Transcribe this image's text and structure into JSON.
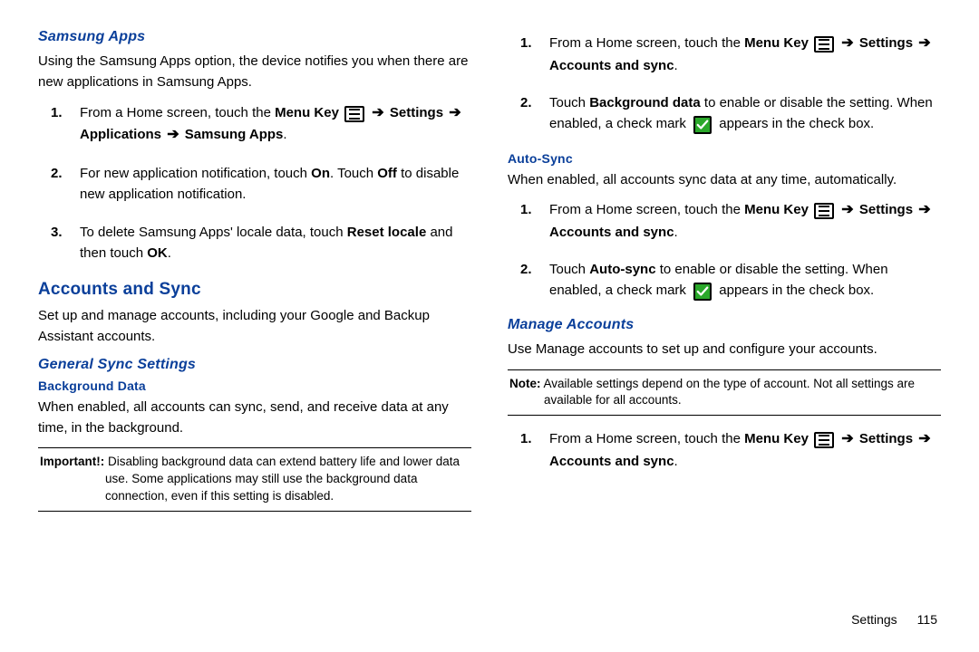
{
  "left": {
    "samsung_apps": {
      "title": "Samsung Apps",
      "intro": "Using the Samsung Apps option, the device notifies you when there are new applications in Samsung Apps.",
      "step1_pre": "From a Home screen, touch the ",
      "menu_key": "Menu Key",
      "settings": "Settings",
      "step1_path2": "Applications",
      "step1_path3": "Samsung Apps",
      "period": ".",
      "step2_a": "For new application notification, touch ",
      "on": "On",
      "step2_b": ". Touch ",
      "off": "Off",
      "step2_c": " to disable new application notification.",
      "step3_a": "To delete Samsung Apps' locale data, touch ",
      "reset_locale": "Reset locale",
      "step3_b": " and then touch ",
      "ok": "OK"
    },
    "accounts": {
      "title": "Accounts and Sync",
      "intro": "Set up and manage accounts, including your Google and Backup Assistant accounts.",
      "general_title": "General Sync Settings",
      "bg_title": "Background Data",
      "bg_intro": "When enabled, all accounts can sync, send, and receive data at any time, in the background.",
      "important_lead": "Important!:",
      "important_body": " Disabling background data can extend battery life and lower data use. Some applications may still use the background data connection, even if this setting is disabled."
    }
  },
  "right": {
    "step1_pre": "From a Home screen, touch the ",
    "menu_key": "Menu Key",
    "settings": "Settings",
    "acct_sync": "Accounts and sync",
    "period": ".",
    "bg2_a": "Touch ",
    "bg2_bold": "Background data",
    "bg2_b": " to enable or disable the setting. When enabled, a check mark ",
    "bg2_c": " appears in the check box.",
    "auto_title": "Auto-Sync",
    "auto_intro": "When enabled, all accounts sync data at any time, automatically.",
    "auto2_a": "Touch ",
    "auto2_bold": "Auto-sync",
    "auto2_b": " to enable or disable the setting. When enabled, a check mark ",
    "auto2_c": " appears in the check box.",
    "manage_title": "Manage Accounts",
    "manage_intro": "Use Manage accounts to set up and configure your accounts.",
    "note_lead": "Note:",
    "note_body": " Available settings depend on the type of account. Not all settings are available for all accounts."
  },
  "footer": {
    "section": "Settings",
    "page": "115"
  },
  "glyphs": {
    "arrow": "➔"
  }
}
